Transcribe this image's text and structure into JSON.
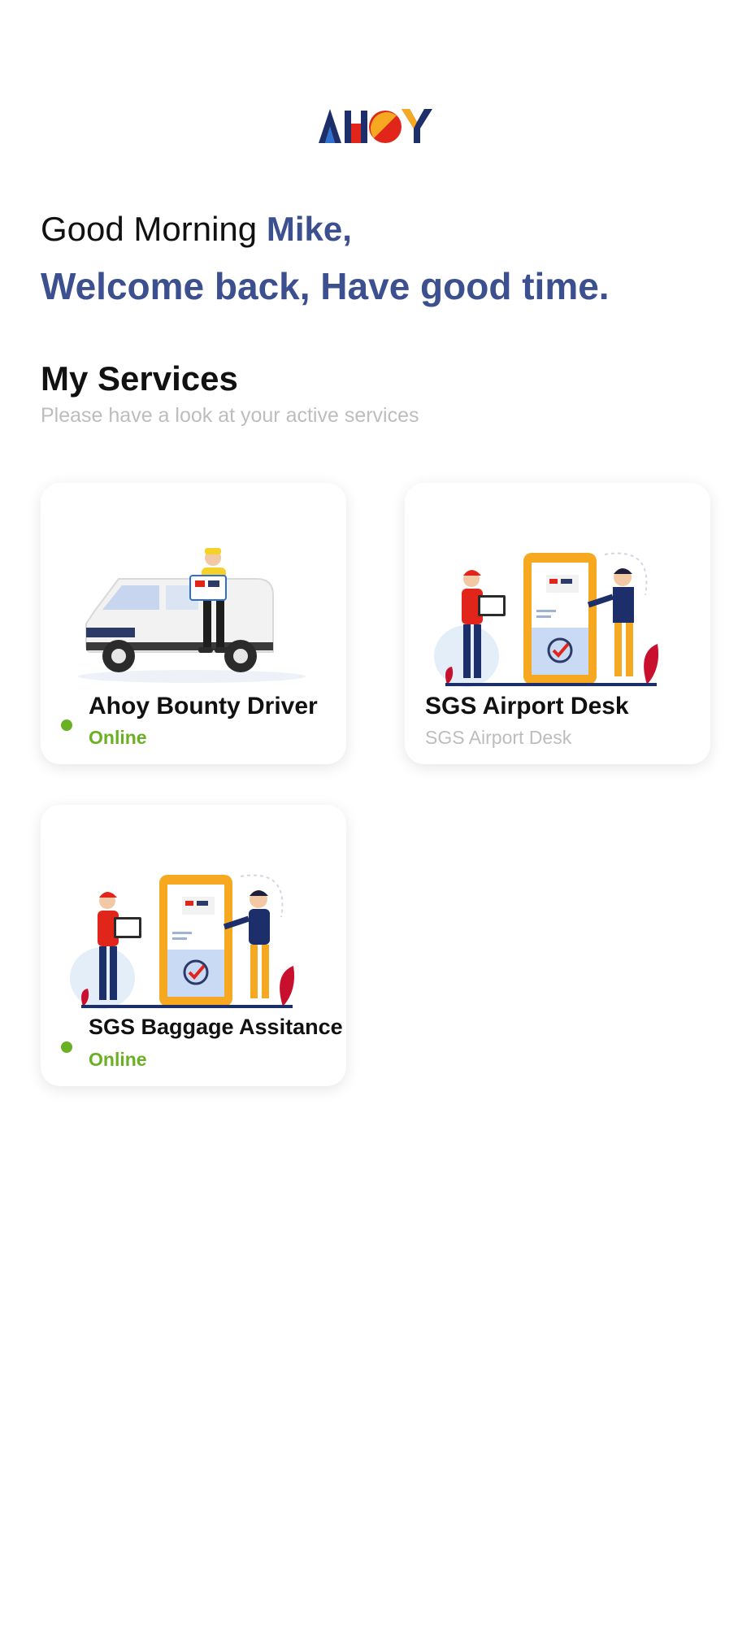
{
  "header": {
    "logo_text": "AHOY"
  },
  "greeting": {
    "prefix": "Good Morning",
    "name": "Mike,",
    "welcome": "Welcome back, Have good time."
  },
  "services_section": {
    "title": "My Services",
    "subtitle": "Please have a look at your active services"
  },
  "services": [
    {
      "title": "Ahoy Bounty Driver",
      "status": "Online",
      "illustration": "delivery-van-illustration"
    },
    {
      "title": "SGS Airport Desk",
      "status": "SGS Airport Desk",
      "illustration": "airport-desk-illustration"
    },
    {
      "title": "SGS Baggage Assitance",
      "status": "Online",
      "illustration": "airport-desk-illustration"
    }
  ],
  "colors": {
    "brand_blue": "#3c4f8f",
    "online_green": "#6ab023",
    "muted_gray": "#bdbdbd",
    "logo_red": "#e1251b",
    "logo_yellow": "#f6a821",
    "logo_navy": "#1d2f6b"
  }
}
